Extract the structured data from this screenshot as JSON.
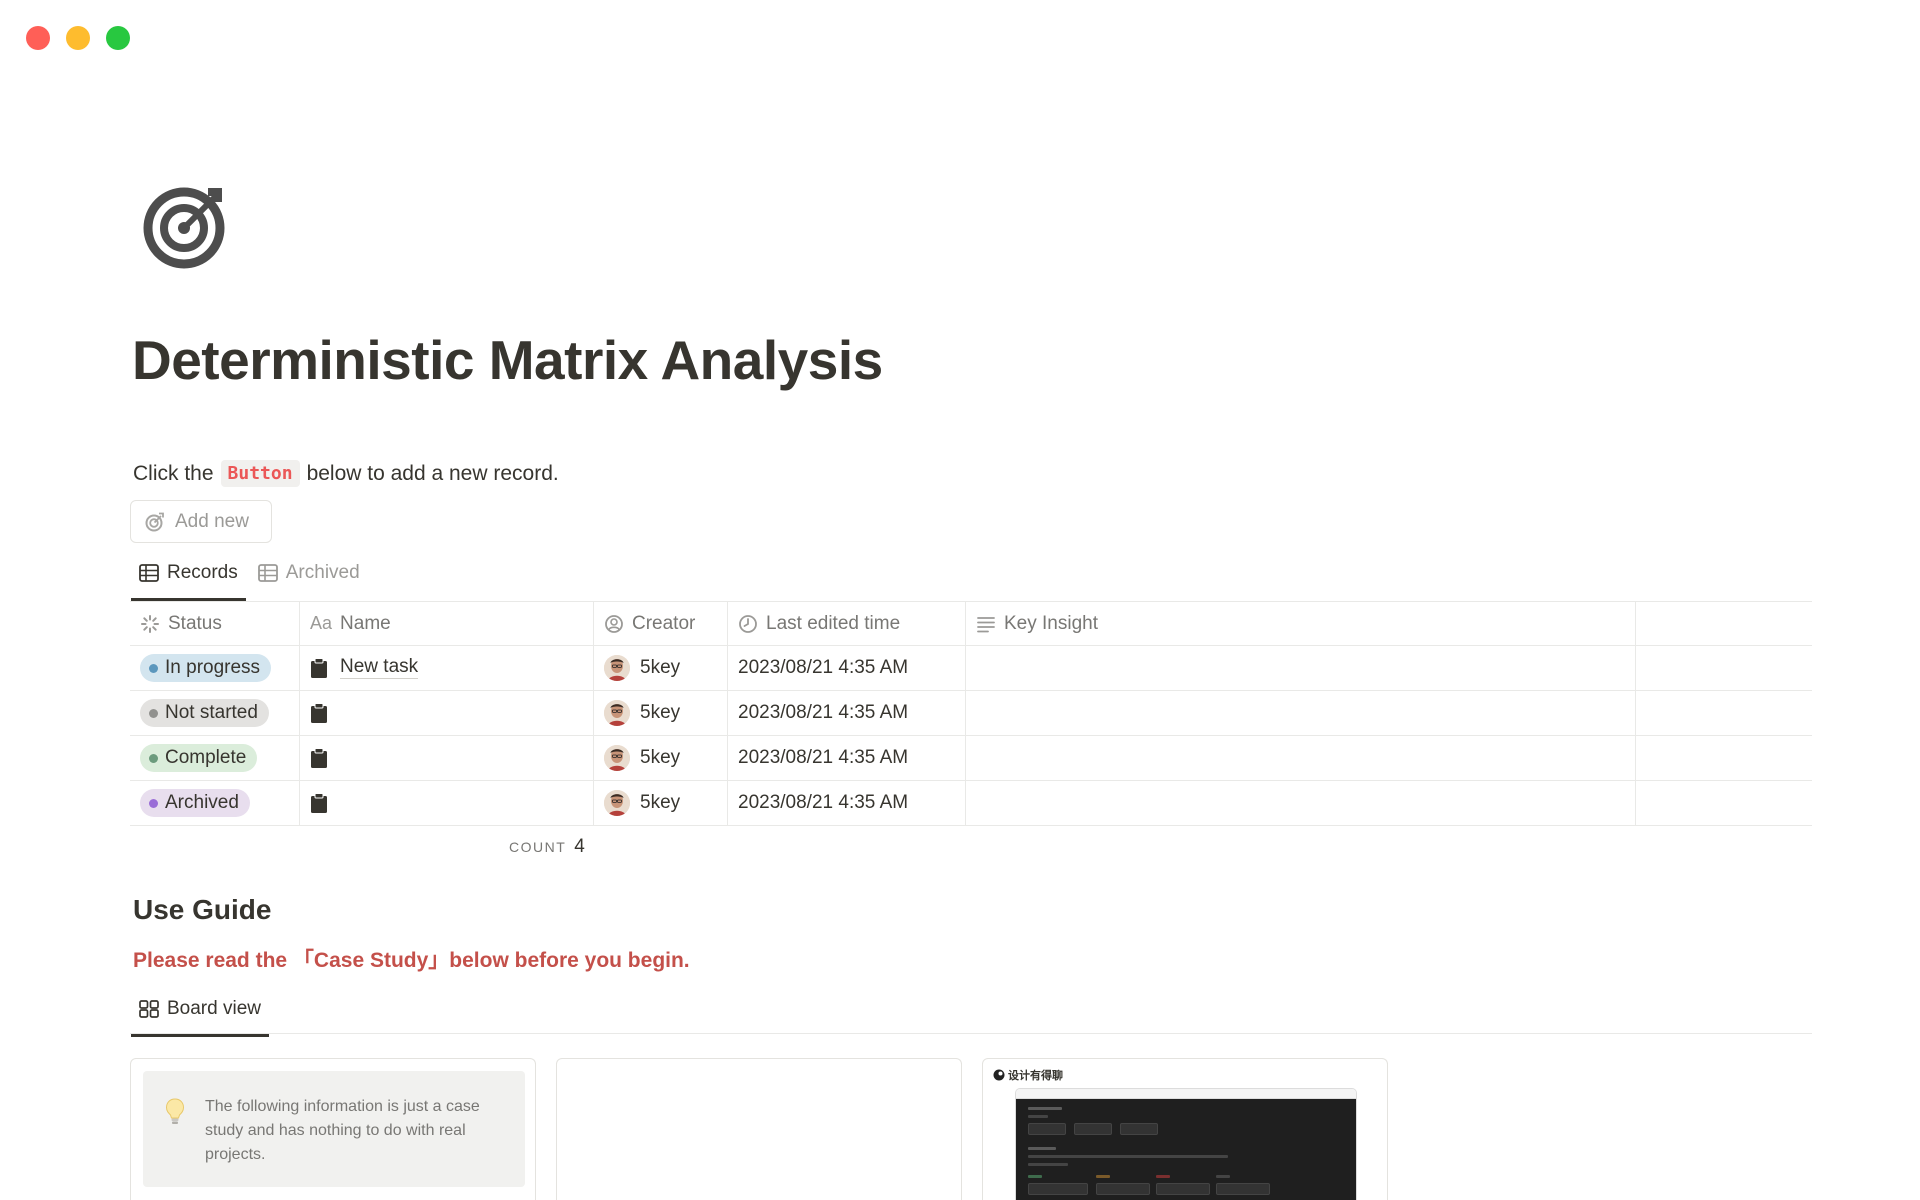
{
  "window": {
    "controls": [
      "close",
      "minimize",
      "maximize"
    ],
    "colors": [
      "#ff5f57",
      "#febc2e",
      "#28c840"
    ]
  },
  "page": {
    "icon": "target-icon",
    "title": "Deterministic Matrix Analysis"
  },
  "intro": {
    "before": "Click the",
    "code": "Button",
    "after": "below to add a new record."
  },
  "add_button": {
    "label": "Add new",
    "icon": "target-icon"
  },
  "views": [
    {
      "label": "Records",
      "icon": "table-icon",
      "active": true
    },
    {
      "label": "Archived",
      "icon": "table-icon",
      "active": false
    }
  ],
  "table": {
    "columns": [
      {
        "label": "Status",
        "icon": "status-icon"
      },
      {
        "label": "Name",
        "icon": "text-icon",
        "icon_text": "Aa"
      },
      {
        "label": "Creator",
        "icon": "person-icon"
      },
      {
        "label": "Last edited time",
        "icon": "clock-icon"
      },
      {
        "label": "Key Insight",
        "icon": "lines-icon"
      },
      {
        "label": "",
        "icon": ""
      }
    ],
    "rows": [
      {
        "status": "In progress",
        "status_bg": "#d3e5ef",
        "status_dot": "#5b97bd",
        "name": "New task",
        "creator": "5key",
        "edited": "2023/08/21 4:35 AM",
        "insight": ""
      },
      {
        "status": "Not started",
        "status_bg": "#e3e2e0",
        "status_dot": "#91918e",
        "name": "",
        "creator": "5key",
        "edited": "2023/08/21 4:35 AM",
        "insight": ""
      },
      {
        "status": "Complete",
        "status_bg": "#dbeddb",
        "status_dot": "#6c9b7d",
        "name": "",
        "creator": "5key",
        "edited": "2023/08/21 4:35 AM",
        "insight": ""
      },
      {
        "status": "Archived",
        "status_bg": "#e8deee",
        "status_dot": "#9a6dd7",
        "name": "",
        "creator": "5key",
        "edited": "2023/08/21 4:35 AM",
        "insight": ""
      }
    ],
    "count_label": "COUNT",
    "count_value": "4"
  },
  "guide": {
    "title": "Use Guide",
    "note": "Please read the 「Case Study」below before you begin.",
    "view": {
      "label": "Board view",
      "icon": "board-icon"
    },
    "cards": [
      {
        "callout": "The following information is just a case study and has nothing to do with real projects.",
        "icon": "bulb-icon"
      },
      {
        "callout": ""
      },
      {
        "brand": "设计有得聊",
        "icon": "brand-logo-icon"
      }
    ]
  }
}
